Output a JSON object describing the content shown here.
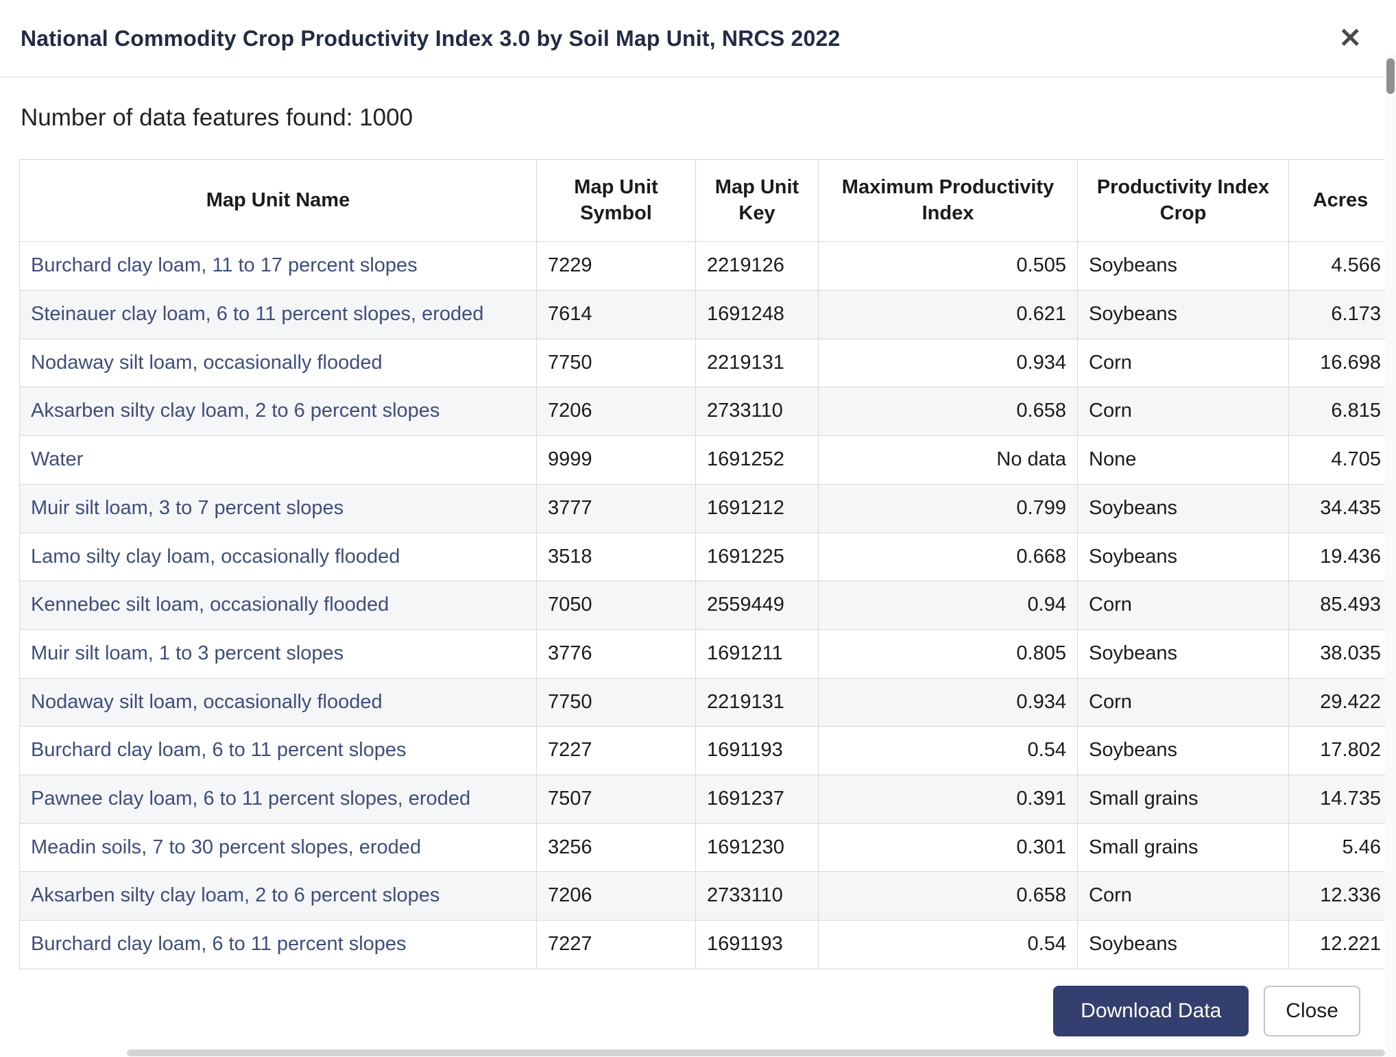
{
  "modal": {
    "title": "National Commodity Crop Productivity Index 3.0 by Soil Map Unit, NRCS 2022",
    "close_icon": "✕",
    "features_found": "Number of data features found: 1000",
    "footer": {
      "download_label": "Download Data",
      "close_label": "Close"
    }
  },
  "table": {
    "headers": [
      "Map Unit Name",
      "Map Unit Symbol",
      "Map Unit Key",
      "Maximum Productivity Index",
      "Productivity Index Crop",
      "Acres"
    ],
    "rows": [
      {
        "name": "Burchard clay loam, 11 to 17 percent slopes",
        "symbol": "7229",
        "key": "2219126",
        "max_index": "0.505",
        "crop": "Soybeans",
        "acres": "4.566"
      },
      {
        "name": "Steinauer clay loam, 6 to 11 percent slopes, eroded",
        "symbol": "7614",
        "key": "1691248",
        "max_index": "0.621",
        "crop": "Soybeans",
        "acres": "6.173"
      },
      {
        "name": "Nodaway silt loam, occasionally flooded",
        "symbol": "7750",
        "key": "2219131",
        "max_index": "0.934",
        "crop": "Corn",
        "acres": "16.698"
      },
      {
        "name": "Aksarben silty clay loam, 2 to 6 percent slopes",
        "symbol": "7206",
        "key": "2733110",
        "max_index": "0.658",
        "crop": "Corn",
        "acres": "6.815"
      },
      {
        "name": "Water",
        "symbol": "9999",
        "key": "1691252",
        "max_index": "No data",
        "crop": "None",
        "acres": "4.705"
      },
      {
        "name": "Muir silt loam, 3 to 7 percent slopes",
        "symbol": "3777",
        "key": "1691212",
        "max_index": "0.799",
        "crop": "Soybeans",
        "acres": "34.435"
      },
      {
        "name": "Lamo silty clay loam, occasionally flooded",
        "symbol": "3518",
        "key": "1691225",
        "max_index": "0.668",
        "crop": "Soybeans",
        "acres": "19.436"
      },
      {
        "name": "Kennebec silt loam, occasionally flooded",
        "symbol": "7050",
        "key": "2559449",
        "max_index": "0.94",
        "crop": "Corn",
        "acres": "85.493"
      },
      {
        "name": "Muir silt loam, 1 to 3 percent slopes",
        "symbol": "3776",
        "key": "1691211",
        "max_index": "0.805",
        "crop": "Soybeans",
        "acres": "38.035"
      },
      {
        "name": "Nodaway silt loam, occasionally flooded",
        "symbol": "7750",
        "key": "2219131",
        "max_index": "0.934",
        "crop": "Corn",
        "acres": "29.422"
      },
      {
        "name": "Burchard clay loam, 6 to 11 percent slopes",
        "symbol": "7227",
        "key": "1691193",
        "max_index": "0.54",
        "crop": "Soybeans",
        "acres": "17.802"
      },
      {
        "name": "Pawnee clay loam, 6 to 11 percent slopes, eroded",
        "symbol": "7507",
        "key": "1691237",
        "max_index": "0.391",
        "crop": "Small grains",
        "acres": "14.735"
      },
      {
        "name": "Meadin soils, 7 to 30 percent slopes, eroded",
        "symbol": "3256",
        "key": "1691230",
        "max_index": "0.301",
        "crop": "Small grains",
        "acres": "5.46"
      },
      {
        "name": "Aksarben silty clay loam, 2 to 6 percent slopes",
        "symbol": "7206",
        "key": "2733110",
        "max_index": "0.658",
        "crop": "Corn",
        "acres": "12.336"
      },
      {
        "name": "Burchard clay loam, 6 to 11 percent slopes",
        "symbol": "7227",
        "key": "1691193",
        "max_index": "0.54",
        "crop": "Soybeans",
        "acres": "12.221"
      }
    ]
  },
  "colors": {
    "link": "#3f4d7d",
    "primary_button": "#333f6e",
    "row_alt": "#f5f6f7",
    "border": "#d8d8d8",
    "title": "#222b45"
  }
}
